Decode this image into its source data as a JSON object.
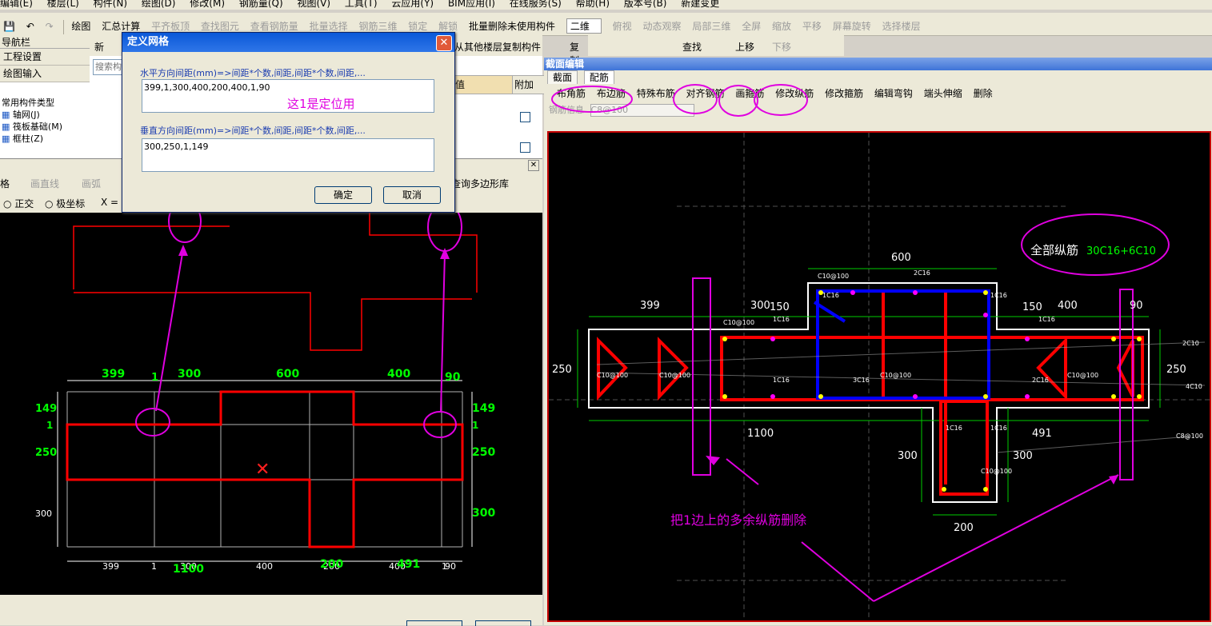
{
  "menu": [
    "编辑(E)",
    "楼层(L)",
    "构件(N)",
    "绘图(D)",
    "修改(M)",
    "钢筋量(Q)",
    "视图(V)",
    "工具(T)",
    "云应用(Y)",
    "BIM应用(I)",
    "在线服务(S)",
    "帮助(H)",
    "版本号(B)",
    "新建变更"
  ],
  "toolbar": {
    "items": [
      "绘图",
      "汇总计算",
      "平齐板顶",
      "查找图元",
      "查看钢筋量",
      "批量选择",
      "钢筋三维",
      "锁定",
      "解锁",
      "批量删除未使用构件",
      "二维",
      "俯视",
      "动态观察",
      "局部三维",
      "全屏",
      "缩放",
      "平移",
      "屏幕旋转",
      "选择楼层"
    ],
    "disabled": [
      2,
      3,
      4,
      5,
      6,
      7,
      8,
      11,
      12,
      13,
      14,
      15,
      16,
      17,
      18
    ]
  },
  "left_panel": {
    "title": "导航栏",
    "nav": [
      "工程设置",
      "绘图输入"
    ],
    "search_placeholder": "搜索构件",
    "tree_header": "常用构件类型",
    "tree": [
      "轴网(J)",
      "筏板基础(M)",
      "框柱(Z)"
    ]
  },
  "mid_toolbar": {
    "new_label": "新",
    "copy_from": "从其他楼层复制构件",
    "copy_to": "复制构件到其他楼层",
    "find": "查找",
    "up": "上移",
    "down": "下移"
  },
  "grid_table": {
    "col_value": "值",
    "col_attach": "附加"
  },
  "dialog": {
    "title": "定义网格",
    "h_label": "水平方向间距(mm)=>间距*个数,间距,间距*个数,间距,...",
    "h_value": "399,1,300,400,200,400,1,90",
    "annotation": "这1是定位用",
    "v_label": "垂直方向间距(mm)=>间距*个数,间距,间距*个数,间距,...",
    "v_value": "300,250,1,149",
    "ok": "确定",
    "cancel": "取消"
  },
  "draw_bar": {
    "b1": "格",
    "line": "画直线",
    "arc": "画弧",
    "query": "查询多边形库"
  },
  "coord_bar": {
    "ortho": "正交",
    "polar": "极坐标",
    "x_label": "X ="
  },
  "left_canvas": {
    "top_dims": [
      "399",
      "1",
      "300",
      "600",
      "400",
      "90"
    ],
    "bottom_dims": [
      "399",
      "1",
      "300",
      "400",
      "200",
      "400",
      "1",
      "90"
    ],
    "bottom_overlay": [
      "1100",
      "200",
      "491"
    ],
    "left_dims": [
      "149",
      "1",
      "250",
      "300"
    ],
    "right_dims": [
      "149",
      "1",
      "250",
      "300"
    ]
  },
  "right_panel": {
    "title": "截面编辑",
    "tabs": [
      "截面",
      "配筋"
    ],
    "tools": [
      "布角筋",
      "布边筋",
      "特殊布筋",
      "对齐钢筋",
      "画箍筋",
      "修改纵筋",
      "修改箍筋",
      "编辑弯钩",
      "端头伸缩",
      "删除"
    ],
    "info_label": "钢筋信息",
    "info_value": "C8@100"
  },
  "right_canvas": {
    "dims": [
      "600",
      "399",
      "300",
      "150",
      "150",
      "400",
      "90",
      "250",
      "250",
      "1100",
      "491",
      "300",
      "300",
      "200"
    ],
    "labels": [
      "C10@100",
      "2C16",
      "1C16",
      "1C16",
      "C10@100",
      "1C16",
      "C10@100",
      "C10@100",
      "1C16",
      "3C16",
      "C10@100",
      "2C16",
      "C10@100",
      "2C10",
      "4C10",
      "C8@100",
      "1C16",
      "1C16",
      "C10@100",
      "1C16"
    ],
    "all_rebar_title": "全部纵筋",
    "all_rebar_value": "30C16+6C10",
    "delete_note": "把1边上的多余纵筋删除"
  },
  "colors": {
    "accent": "#e000e0",
    "line": "#ff0000",
    "dim": "#00ff00",
    "stirrup_blue": "#0000ff"
  }
}
